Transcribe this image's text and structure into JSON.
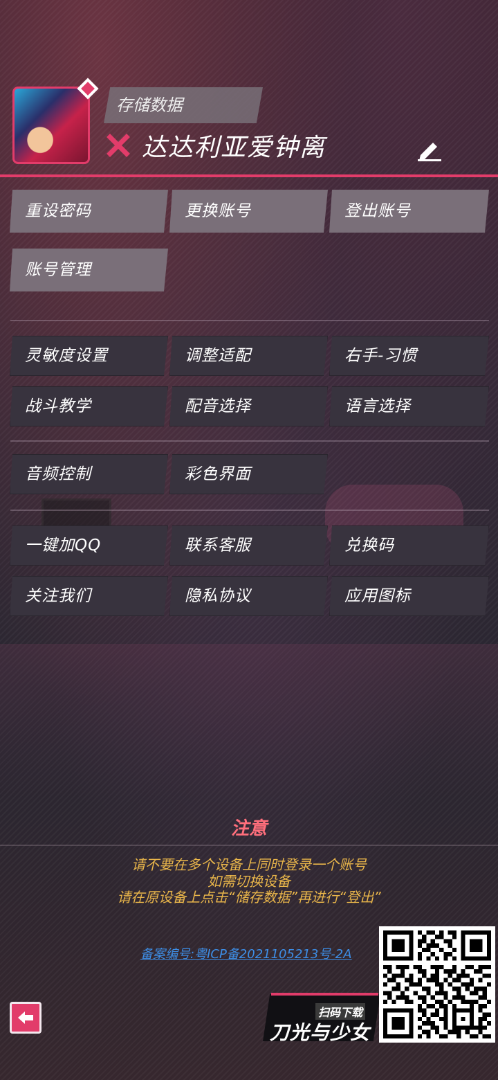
{
  "header": {
    "save_label": "存储数据",
    "player_name": "达达利亚爱钟离"
  },
  "buttons": {
    "row1": [
      "重设密码",
      "更换账号",
      "登出账号"
    ],
    "row2": [
      "账号管理"
    ],
    "row3": [
      "灵敏度设置",
      "调整适配",
      "右手-习惯"
    ],
    "row4": [
      "战斗教学",
      "配音选择",
      "语言选择"
    ],
    "row5": [
      "音频控制",
      "彩色界面"
    ],
    "row6": [
      "一键加QQ",
      "联系客服",
      "兑换码"
    ],
    "row7": [
      "关注我们",
      "隐私协议",
      "应用图标"
    ]
  },
  "notice": {
    "title": "注意",
    "line1": "请不要在多个设备上同时登录一个账号",
    "line2": "如需切换设备",
    "line3": "请在原设备上点击“储存数据”再进行“登出”"
  },
  "icp": "备案编号:粤ICP备2021105213号-2A",
  "promo": {
    "small": "扫码下载",
    "big": "刀光与少女"
  },
  "colors": {
    "accent": "#e23c6a",
    "notice_title": "#ff6f7c",
    "notice_text": "#e8b54a",
    "link": "#3d8ee6"
  },
  "icons": [
    "x-icon",
    "edit-icon",
    "back-arrow-icon",
    "qr-code"
  ]
}
